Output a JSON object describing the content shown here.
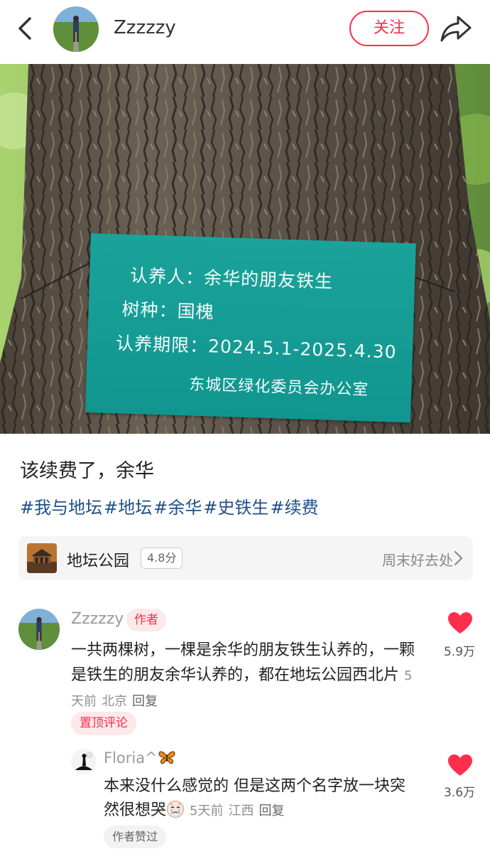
{
  "header": {
    "username": "Zzzzzy",
    "follow_label": "关注"
  },
  "photo": {
    "sign_lines": [
      "认养人：余华的朋友铁生",
      "树种：国槐",
      "认养期限：2024.5.1-2025.4.30",
      "东城区绿化委员会办公室"
    ]
  },
  "post": {
    "title": "该续费了，余华",
    "tags": [
      "#我与地坛",
      "#地坛",
      "#余华",
      "#史铁生",
      "#续费"
    ]
  },
  "location": {
    "name": "地坛公园",
    "score": "4.8分",
    "right_text": "周末好去处"
  },
  "comments": [
    {
      "name": "Zzzzzy",
      "badge": "作者",
      "text": "一共两棵树，一棵是余华的朋友铁生认养的，一颗是铁生的朋友余华认养的，都在地坛公园西北片",
      "time": "5天前",
      "place": "北京",
      "reply_label": "回复",
      "pin_label": "置顶评论",
      "likes": "5.9万",
      "reply": {
        "name": "Floria^",
        "text": "本来没什么感觉的 但是这两个名字放一块突然很想哭",
        "time": "5天前",
        "place": "江西",
        "reply_label": "回复",
        "liked_label": "作者赞过",
        "likes": "3.6万"
      }
    }
  ],
  "colors": {
    "accent": "#ff2e4d",
    "tag_blue": "#1f4f8a",
    "sign_teal": "#15a098"
  },
  "icons": [
    "back-arrow-icon",
    "share-icon",
    "chevron-right-icon",
    "heart-icon",
    "butterfly-icon",
    "crying-emoji-icon"
  ]
}
